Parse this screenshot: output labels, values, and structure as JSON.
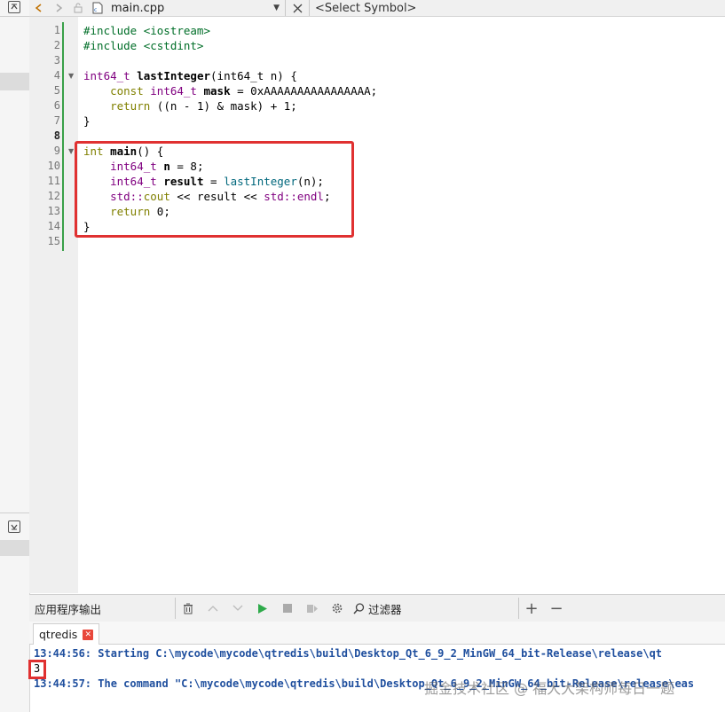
{
  "toolbar": {
    "file_name": "main.cpp",
    "symbol_placeholder": "<Select Symbol>"
  },
  "editor": {
    "line_numbers": [
      "1",
      "2",
      "3",
      "4",
      "5",
      "6",
      "7",
      "8",
      "9",
      "10",
      "11",
      "12",
      "13",
      "14",
      "15"
    ],
    "lines": {
      "l1": "#include <iostream>",
      "l2": "#include <cstdint>",
      "l4_type": "int64_t",
      "l4_name": "lastInteger",
      "l4_params": "(int64_t n) {",
      "l5_const": "const",
      "l5_type": "int64_t",
      "l5_var": "mask",
      "l5_rest": " = 0xAAAAAAAAAAAAAAAA;",
      "l6_return": "return",
      "l6_rest": " ((n - 1) & mask) + 1;",
      "l7": "}",
      "l9_int": "int",
      "l9_main": "main",
      "l9_rest": "() {",
      "l10_type": "int64_t",
      "l10_var": "n",
      "l10_rest": " = 8;",
      "l11_type": "int64_t",
      "l11_var": "result",
      "l11_eq": " = ",
      "l11_call": "lastInteger",
      "l11_rest": "(n);",
      "l12_std": "std::",
      "l12_cout": "cout",
      "l12_ops": " << result << ",
      "l12_std2": "std::",
      "l12_endl": "endl",
      "l12_end": ";",
      "l13_return": "return",
      "l13_rest": " 0;",
      "l14": "}"
    }
  },
  "output_panel": {
    "title": "应用程序输出",
    "filter_label": "过滤器",
    "add_label": "+",
    "remove_label": "−",
    "tab_label": "qtredis",
    "lines": [
      "13:44:56: Starting C:\\mycode\\mycode\\qtredis\\build\\Desktop_Qt_6_9_2_MinGW_64_bit-Release\\release\\qt",
      "3",
      "13:44:57: The command \"C:\\mycode\\mycode\\qtredis\\build\\Desktop_Qt_6_9_2_MinGW_64_bit-Release\\release\\eas"
    ]
  },
  "watermark": "掘金技术社区 @ 福大大架构师每日一题",
  "colors": {
    "highlight": "#e03131",
    "output_text": "#1f4f9e",
    "run_green": "#2eaa4a"
  }
}
